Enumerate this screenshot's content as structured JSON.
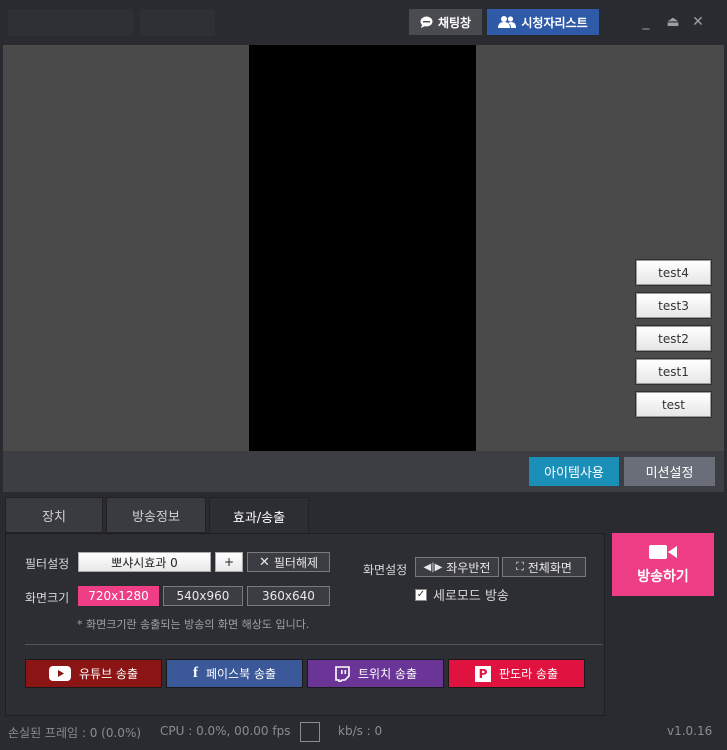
{
  "header": {
    "chat_label": "채팅창",
    "viewers_label": "시청자리스트",
    "minimize": "_",
    "restore": "⏏",
    "close": "✕"
  },
  "preview": {
    "test_buttons": [
      "test4",
      "test3",
      "test2",
      "test1",
      "test"
    ]
  },
  "actions": {
    "item_use": "아이템사용",
    "mission_settings": "미션설정"
  },
  "tabs": [
    {
      "label": "장치",
      "active": false
    },
    {
      "label": "방송정보",
      "active": false
    },
    {
      "label": "효과/송출",
      "active": true
    }
  ],
  "effects": {
    "filter_label": "필터설정",
    "filter_value": "뽀샤시효과 0",
    "filter_add": "+",
    "filter_clear": "필터해제",
    "size_label": "화면크기",
    "sizes": [
      "720x1280",
      "540x960",
      "360x640"
    ],
    "selected_size": "720x1280",
    "screen_label": "화면설정",
    "flip_label": "좌우반전",
    "fullscreen_label": "전체화면",
    "portrait_label": "세로모드 방송",
    "portrait_checked": true,
    "note": "* 화면크기란 송출되는 방송의 화면 해상도 입니다."
  },
  "stream_targets": [
    {
      "label": "유튜브 송출",
      "icon": "youtube-icon",
      "color": "#8b1414"
    },
    {
      "label": "페이스북 송출",
      "icon": "facebook-icon",
      "color": "#3b5998"
    },
    {
      "label": "트위치 송출",
      "icon": "twitch-icon",
      "color": "#6a3597"
    },
    {
      "label": "판도라 송출",
      "icon": "pandora-icon",
      "color": "#e0123f"
    }
  ],
  "broadcast_label": "방송하기",
  "status": {
    "lost_frames": "손실된 프레임 : 0 (0.0%)",
    "cpu": "CPU : 0.0%, 00.00 fps",
    "kbps": "kb/s : 0",
    "version": "v1.0.16"
  },
  "colors": {
    "accent_pink": "#ee3f86",
    "accent_blue": "#1a8fb8",
    "chat_button": "#4a4b50",
    "viewers_button": "#2f5aa8"
  }
}
